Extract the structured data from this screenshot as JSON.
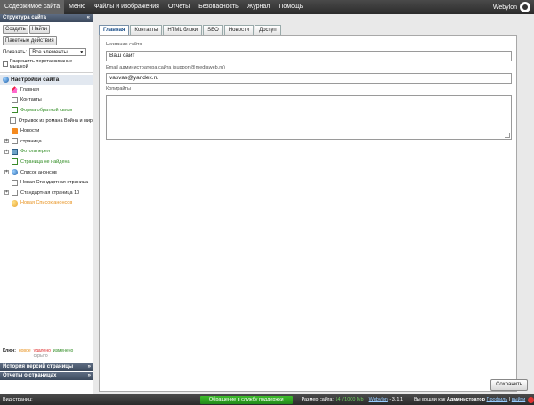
{
  "topbar": {
    "items": [
      "Содержимое сайта",
      "Меню",
      "Файлы и изображения",
      "Отчеты",
      "Безопасность",
      "Журнал",
      "Помощь"
    ],
    "brand": "Webylon"
  },
  "sidebar": {
    "structure_title": "Структура сайта",
    "create_label": "Создать",
    "find_label": "Найти",
    "batch_label": "Пакетные действия",
    "show_label": "Показать:",
    "show_value": "Все элементы",
    "dragdrop_label": "Разрешить перетаскивание мышкой",
    "root_label": "Настройки сайта",
    "items": [
      "Главная",
      "Контакты",
      "Форма обратной связи",
      "Отрывок из романа Война и мир",
      "Новости",
      "страница",
      "Фотогалерея",
      "Страница не найдена",
      "Список анонсов",
      "Новая Стандартная страница",
      "Стандартная страница 10",
      "Новая Список анонсов"
    ],
    "legend": {
      "key": "Ключ:",
      "new": "новое",
      "deleted": "удалено",
      "changed": "изменено",
      "hidden": "скрыто"
    },
    "history_title": "История версий страницы",
    "reports_title": "Отчеты о страницах"
  },
  "tabs": [
    "Главная",
    "Контакты",
    "HTML блоки",
    "SEO",
    "Новости",
    "Доступ"
  ],
  "form": {
    "site_name_label": "Название сайта",
    "site_name_value": "Ваш сайт",
    "admin_email_label": "Email администратора сайта (support@mediaweb.ru)",
    "admin_email_value": "vasvas@yandex.ru",
    "copyright_label": "Копирайты",
    "save_label": "Сохранить"
  },
  "statusbar": {
    "view_label": "Вид страниц:",
    "support_label": "Обращение в службу поддержки",
    "size_label": "Размер сайта:",
    "size_value": "14 / 1000 Mb",
    "brand": "Webylon",
    "version": "- 3.1.1",
    "logged_label": "Вы вошли как",
    "user": "Администратор",
    "profile": "Профиль",
    "logout": "выйти"
  },
  "colors": {
    "accent": "#1b4f8a",
    "support_green": "#2aa21f",
    "panel_head": "#4a5870"
  }
}
